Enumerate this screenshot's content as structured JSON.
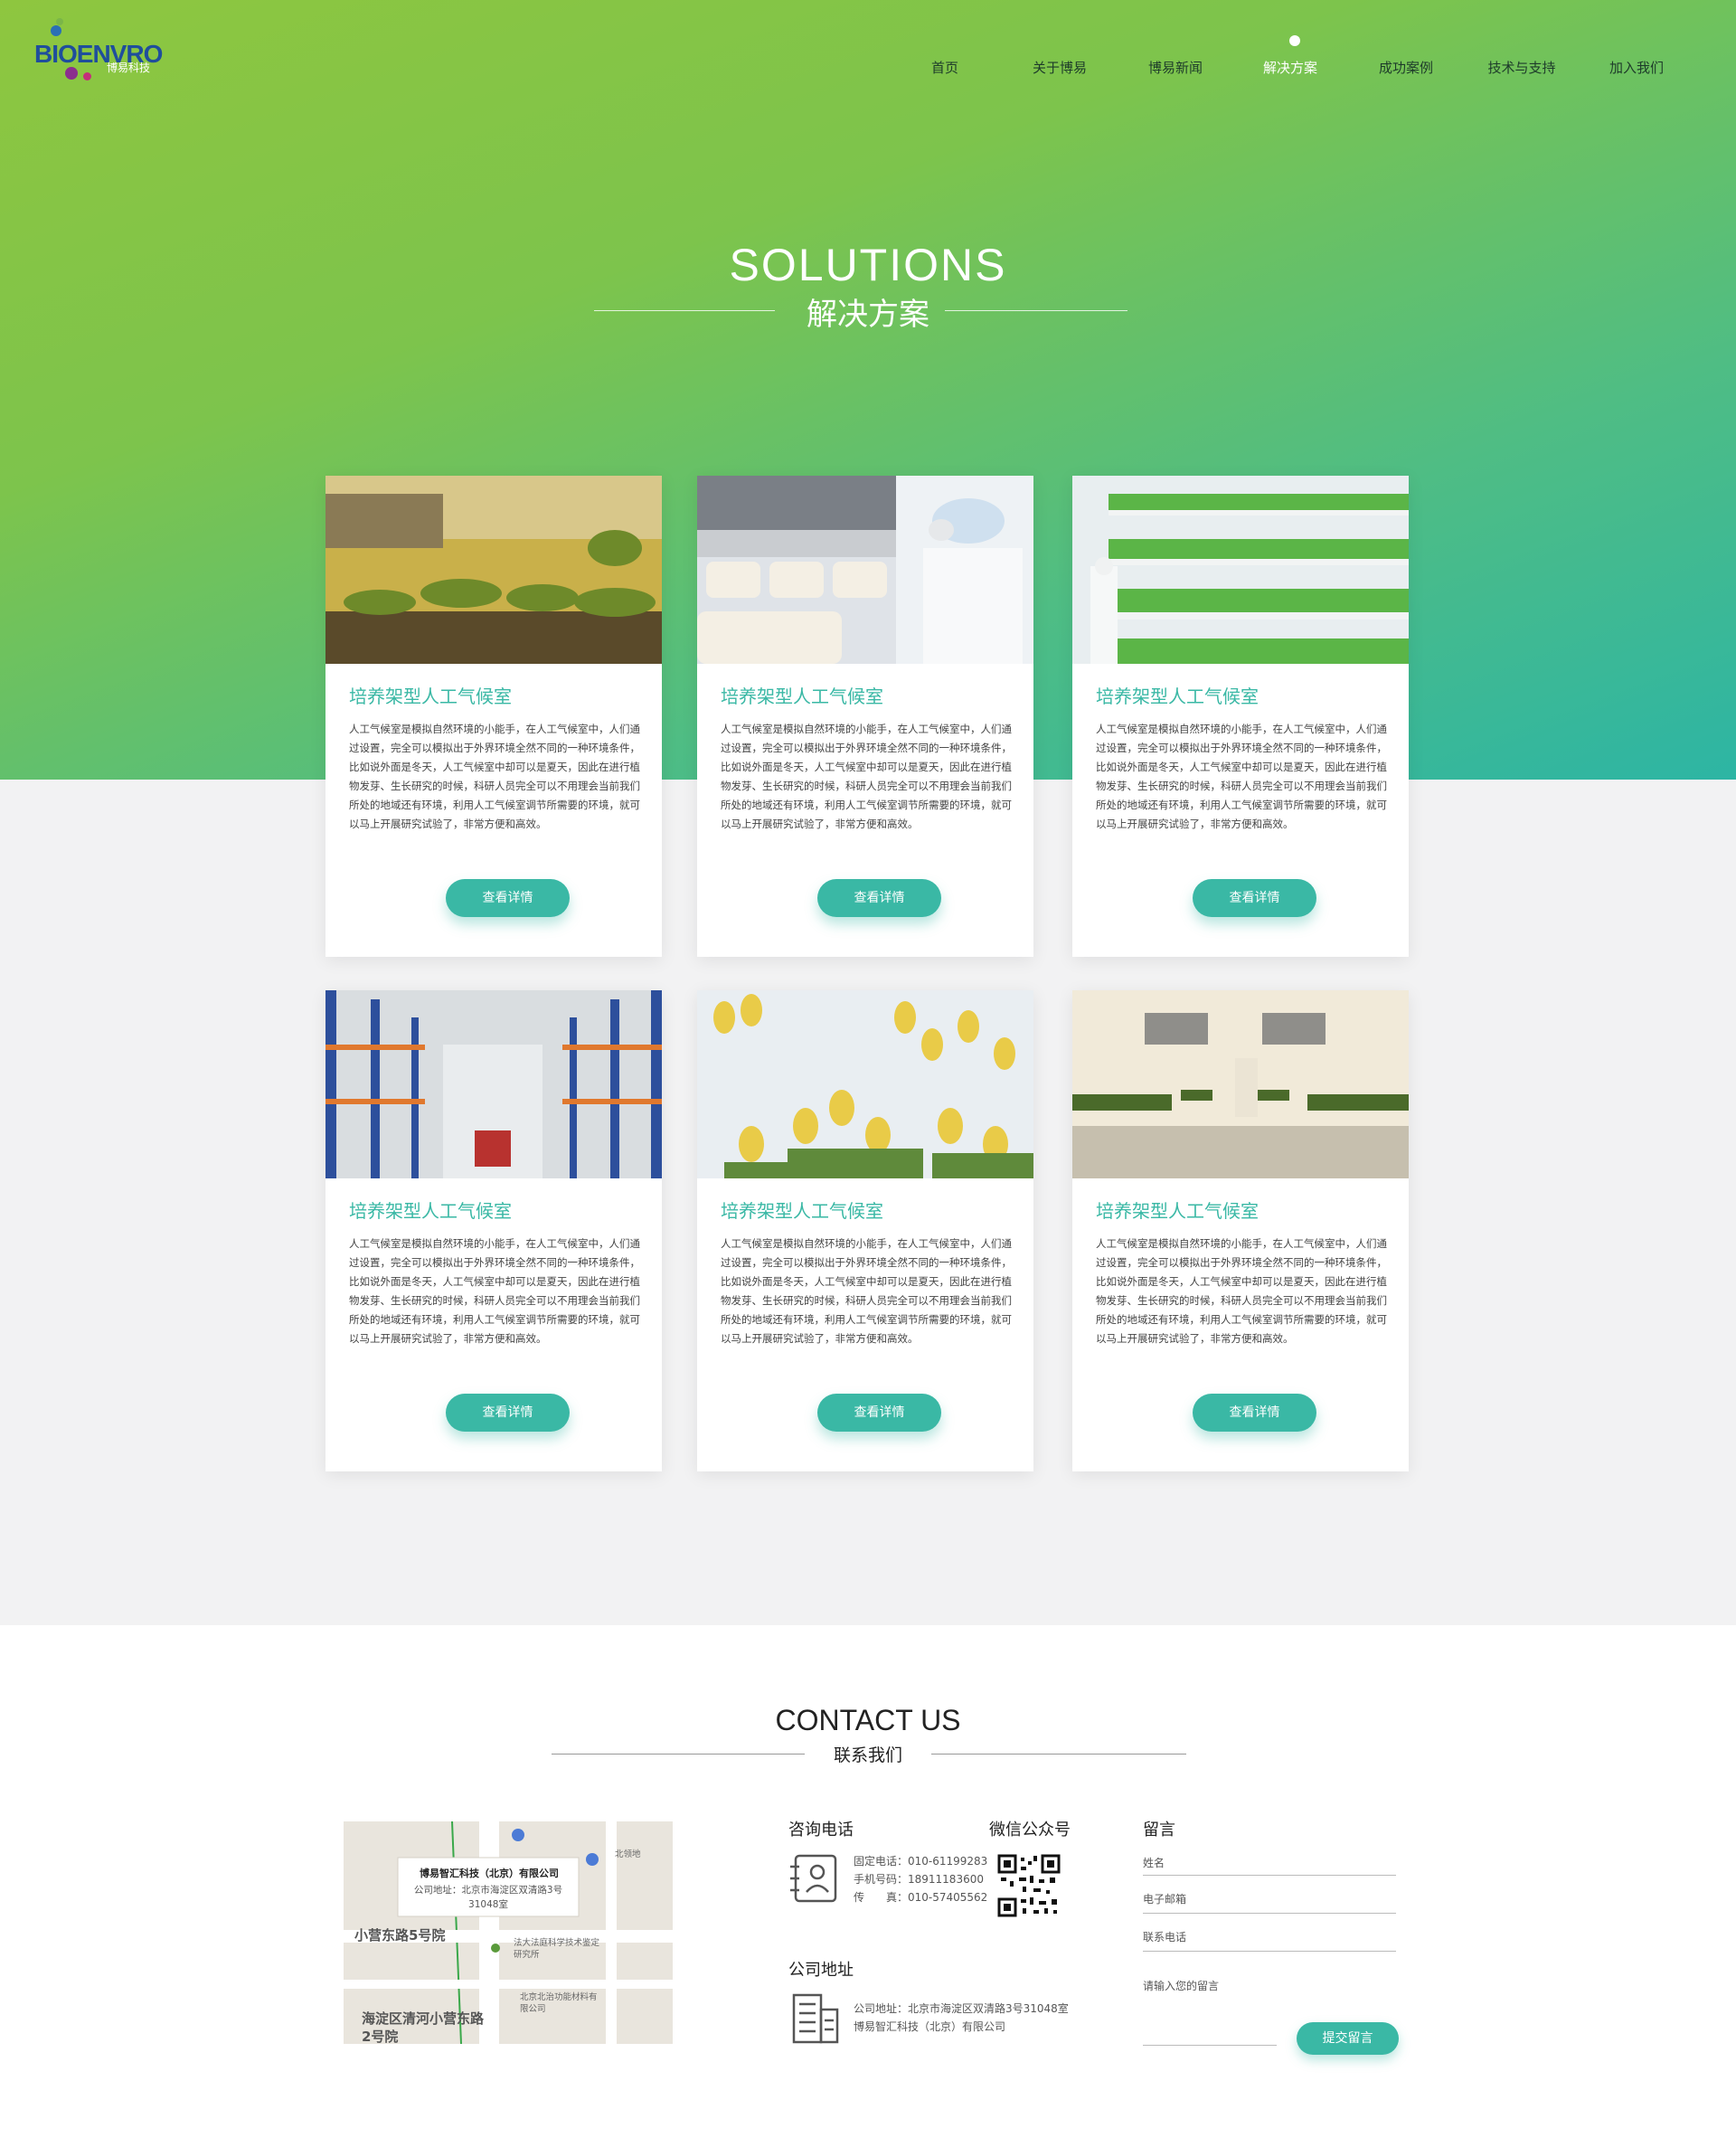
{
  "brand": {
    "name": "BIOENVRO",
    "sub": "博易科技"
  },
  "nav": {
    "items": [
      "首页",
      "关于博易",
      "博易新闻",
      "解决方案",
      "成功案例",
      "技术与支持",
      "加入我们"
    ],
    "active": "解决方案"
  },
  "solutions": {
    "title_en": "SOLUTIONS",
    "title_cn": "解决方案"
  },
  "cards": [
    {
      "title": "培养架型人工气候室",
      "desc": "人工气候室是模拟自然环境的小能手，在人工气候室中，人们通过设置，完全可以模拟出于外界环境全然不同的一种环境条件，比如说外面是冬天，人工气候室中却可以是夏天，因此在进行植物发芽、生长研究的时候，科研人员完全可以不用理会当前我们所处的地域还有环境，利用人工气候室调节所需要的环境，就可以马上开展研究试验了，非常方便和高效。",
      "button": "查看详情",
      "image": "plants-under-lights"
    },
    {
      "title": "培养架型人工气候室",
      "desc": "人工气候室是模拟自然环境的小能手，在人工气候室中，人们通过设置，完全可以模拟出于外界环境全然不同的一种环境条件，比如说外面是冬天，人工气候室中却可以是夏天，因此在进行植物发芽、生长研究的时候，科研人员完全可以不用理会当前我们所处的地域还有环境，利用人工气候室调节所需要的环境，就可以马上开展研究试验了，非常方便和高效。",
      "button": "查看详情",
      "image": "mushroom-lab-worker"
    },
    {
      "title": "培养架型人工气候室",
      "desc": "人工气候室是模拟自然环境的小能手，在人工气候室中，人们通过设置，完全可以模拟出于外界环境全然不同的一种环境条件，比如说外面是冬天，人工气候室中却可以是夏天，因此在进行植物发芽、生长研究的时候，科研人员完全可以不用理会当前我们所处的地域还有环境，利用人工气候室调节所需要的环境，就可以马上开展研究试验了，非常方便和高效。",
      "button": "查看详情",
      "image": "vertical-farm-lettuce"
    },
    {
      "title": "培养架型人工气候室",
      "desc": "人工气候室是模拟自然环境的小能手，在人工气候室中，人们通过设置，完全可以模拟出于外界环境全然不同的一种环境条件，比如说外面是冬天，人工气候室中却可以是夏天，因此在进行植物发芽、生长研究的时候，科研人员完全可以不用理会当前我们所处的地域还有环境，利用人工气候室调节所需要的环境，就可以马上开展研究试验了，非常方便和高效。",
      "button": "查看详情",
      "image": "warehouse-racks"
    },
    {
      "title": "培养架型人工气候室",
      "desc": "人工气候室是模拟自然环境的小能手，在人工气候室中，人们通过设置，完全可以模拟出于外界环境全然不同的一种环境条件，比如说外面是冬天，人工气候室中却可以是夏天，因此在进行植物发芽、生长研究的时候，科研人员完全可以不用理会当前我们所处的地域还有环境，利用人工气候室调节所需要的环境，就可以马上开展研究试验了，非常方便和高效。",
      "button": "查看详情",
      "image": "tulip-bouquets"
    },
    {
      "title": "培养架型人工气候室",
      "desc": "人工气候室是模拟自然环境的小能手，在人工气候室中，人们通过设置，完全可以模拟出于外界环境全然不同的一种环境条件，比如说外面是冬天，人工气候室中却可以是夏天，因此在进行植物发芽、生长研究的时候，科研人员完全可以不用理会当前我们所处的地域还有环境，利用人工气候室调节所需要的环境，就可以马上开展研究试验了，非常方便和高效。",
      "button": "查看详情",
      "image": "climate-chamber-room"
    }
  ],
  "contact": {
    "title_en": "CONTACT US",
    "title_cn": "联系我们",
    "map": {
      "company": "博易智汇科技（北京）有限公司",
      "address": "公司地址：北京市海淀区双清路3号31048室",
      "labels": [
        "小营东路5号院",
        "海淀区清河小营东路2号院",
        "北京北治功能材料有限公司",
        "法大法庭科学技术鉴定研究所",
        "北领地"
      ]
    },
    "phone": {
      "heading": "咨询电话",
      "lines": [
        "固定电话：010-61199283",
        "手机号码：18911183600",
        "传　　真：010-57405562"
      ]
    },
    "wechat": {
      "heading": "微信公众号"
    },
    "address": {
      "heading": "公司地址",
      "lines": [
        "公司地址：北京市海淀区双清路3号31048室",
        "博易智汇科技（北京）有限公司"
      ]
    },
    "form": {
      "heading": "留言",
      "name_placeholder": "姓名",
      "email_placeholder": "电子邮箱",
      "phone_placeholder": "联系电话",
      "message_placeholder": "请输入您的留言",
      "submit": "提交留言"
    }
  },
  "colors": {
    "accent": "#3ab8a5",
    "hero_start": "#8ec63f",
    "hero_end": "#2db5a4"
  }
}
